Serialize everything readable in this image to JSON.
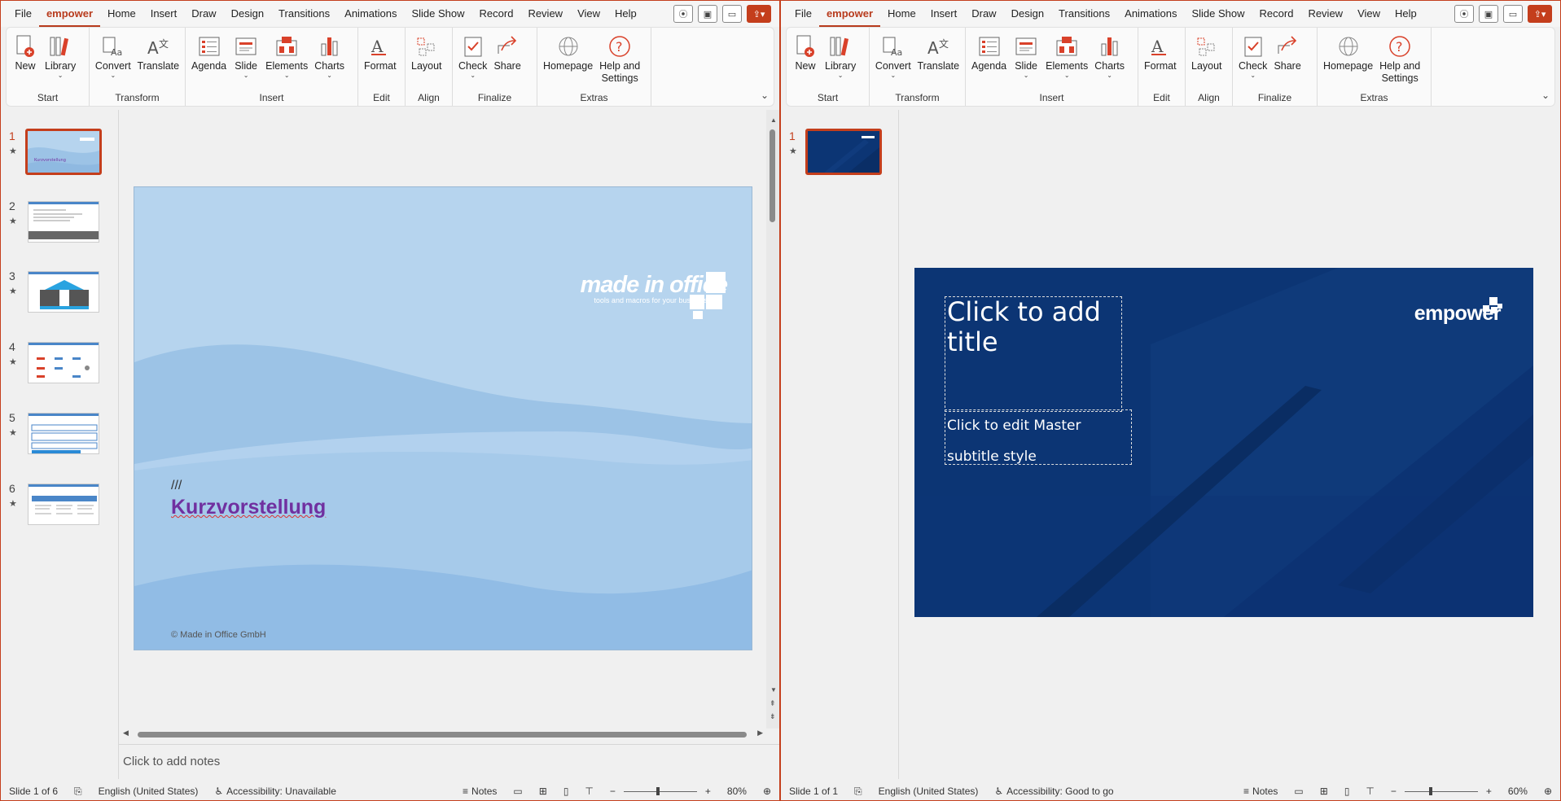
{
  "menu": [
    "File",
    "empower",
    "Home",
    "Insert",
    "Draw",
    "Design",
    "Transitions",
    "Animations",
    "Slide Show",
    "Record",
    "Review",
    "View",
    "Help"
  ],
  "ribbon": {
    "start": {
      "label": "Start",
      "new": "New",
      "library": "Library"
    },
    "transform": {
      "label": "Transform",
      "convert": "Convert",
      "translate": "Translate"
    },
    "insert": {
      "label": "Insert",
      "agenda": "Agenda",
      "slide": "Slide",
      "elements": "Elements",
      "charts": "Charts"
    },
    "edit": {
      "label": "Edit",
      "format": "Format"
    },
    "align": {
      "label": "Align",
      "layout": "Layout"
    },
    "finalize": {
      "label": "Finalize",
      "check": "Check",
      "share": "Share"
    },
    "extras": {
      "label": "Extras",
      "homepage": "Homepage",
      "help_line1": "Help and",
      "help_line2": "Settings"
    }
  },
  "left": {
    "thumbnails": [
      {
        "num": "1",
        "star": "★"
      },
      {
        "num": "2",
        "star": "★"
      },
      {
        "num": "3",
        "star": "★"
      },
      {
        "num": "4",
        "star": "★"
      },
      {
        "num": "5",
        "star": "★"
      },
      {
        "num": "6",
        "star": "★"
      }
    ],
    "slide": {
      "logo_text": "made in office",
      "logo_tagline": "tools and macros for your business",
      "slashes": "///",
      "title": "Kurzvorstellung",
      "footer": "© Made in Office GmbH"
    },
    "notes_placeholder": "Click to add notes",
    "status": {
      "slide_info": "Slide 1 of 6",
      "language": "English (United States)",
      "accessibility": "Accessibility: Unavailable",
      "notes": "Notes",
      "zoom": "80%"
    }
  },
  "right": {
    "thumbnails": [
      {
        "num": "1",
        "star": "★"
      }
    ],
    "slide": {
      "logo_text": "empower",
      "title_placeholder_line1": "Click to add",
      "title_placeholder_line2": "title",
      "subtitle_line1": "Click to edit Master",
      "subtitle_line2": "subtitle style"
    },
    "status": {
      "slide_info": "Slide 1 of 1",
      "language": "English (United States)",
      "accessibility": "Accessibility: Good to go",
      "notes": "Notes",
      "zoom": "60%"
    }
  },
  "colors": {
    "accent": "#c43e1c",
    "slide_light_blue": "#b6d4ee",
    "slide_dark_blue": "#0c3574",
    "title_purple": "#7030a0"
  }
}
